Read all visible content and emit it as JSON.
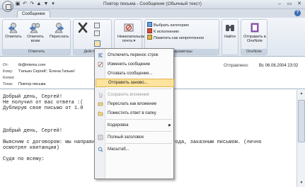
{
  "window": {
    "title": "Повтор письма - Сообщение (Обычный текст)",
    "qat": [
      "▣",
      "↶",
      "↷",
      "▲",
      "▼",
      "▾"
    ],
    "controls": [
      "–",
      "▭",
      "✕"
    ]
  },
  "tabs": {
    "active": "Сообщение",
    "help": "?"
  },
  "ribbon": {
    "reply": "Ответить",
    "reply_all": "Ответить всем",
    "forward": "Переслать",
    "respond_group": "Ответить",
    "delete_group": "Действия",
    "junk": "Нежелательная почта",
    "junk_arrow": "▾",
    "categorize": "Выбрать категорию",
    "followup": "К исполнению",
    "mark_unread": "Пометить как непрочтенное",
    "options_group": "Параметры",
    "find": "Найти",
    "onenote": "Отправить в OneNote",
    "onenote_group": "OneNote"
  },
  "header": {
    "from_label": "От:",
    "from_value": "tb@intems.com",
    "to_label": "Кому:",
    "to_value": "'Гильин Сергей'; 'Елена Гильин'",
    "cc_label": "Копия:",
    "cc_value": "",
    "subject_label": "Тема:",
    "subject_value": "Повтор письма",
    "sent_label": "Отправлено:",
    "sent_value": "Вс 06.06.2004 23:02"
  },
  "body_lines": [
    "Добрый день, Сергей!",
    "Не получил от вас ответа :(",
    "Дублирую свое письмо от 1.0",
    "",
    "",
    "",
    "Добрый день, Сергей!",
    "",
    "Выясним с договором: мы направили его вам 27 апреля 2005 года, заказным письмом. (лично",
    "осмотрел квитанции)",
    "",
    "Судя по всему:"
  ],
  "menu": {
    "items": [
      {
        "label": "Отключить перенос строк",
        "state": "normal"
      },
      {
        "label": "Изменить сообщение",
        "state": "normal"
      },
      {
        "label": "Отозвать сообщение...",
        "state": "normal"
      },
      {
        "label": "Отправить заново...",
        "state": "highlighted"
      },
      {
        "label": "Сохранить вложения",
        "state": "disabled"
      },
      {
        "label": "Переслать как вложение",
        "state": "normal"
      },
      {
        "label": "Поместить ответ в папку",
        "state": "normal"
      },
      {
        "label": "Кодировка",
        "state": "normal"
      },
      {
        "label": "Полный заголовок",
        "state": "normal"
      },
      {
        "label": "Масштаб...",
        "state": "normal"
      }
    ]
  },
  "colors": {
    "ribbon_accent": "#3b6fb0",
    "menu_highlight": "#fde39d"
  }
}
